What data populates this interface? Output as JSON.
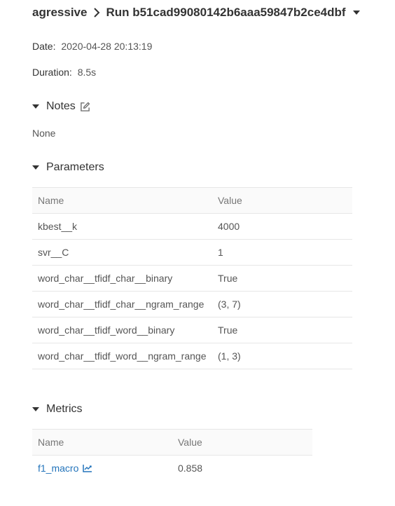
{
  "breadcrumb": {
    "experiment": "agressive",
    "run": "Run b51cad99080142b6aaa59847b2ce4dbf"
  },
  "meta": {
    "date_label": "Date:",
    "date_value": "2020-04-28 20:13:19",
    "duration_label": "Duration:",
    "duration_value": "8.5s"
  },
  "notes": {
    "title": "Notes",
    "text": "None"
  },
  "parameters": {
    "title": "Parameters",
    "columns": [
      "Name",
      "Value"
    ],
    "rows": [
      {
        "name": "kbest__k",
        "value": "4000"
      },
      {
        "name": "svr__C",
        "value": "1"
      },
      {
        "name": "word_char__tfidf_char__binary",
        "value": "True"
      },
      {
        "name": "word_char__tfidf_char__ngram_range",
        "value": "(3, 7)"
      },
      {
        "name": "word_char__tfidf_word__binary",
        "value": "True"
      },
      {
        "name": "word_char__tfidf_word__ngram_range",
        "value": "(1, 3)"
      }
    ]
  },
  "metrics": {
    "title": "Metrics",
    "columns": [
      "Name",
      "Value"
    ],
    "rows": [
      {
        "name": "f1_macro",
        "value": "0.858"
      }
    ]
  },
  "colors": {
    "link": "#2374bb",
    "text": "#333333",
    "border": "#e6e6e6"
  },
  "icons": {
    "breadcrumb_separator": "chevron-right-icon",
    "run_menu": "caret-down-icon",
    "section_toggle": "caret-down-icon",
    "notes_edit": "edit-icon",
    "metric_chart": "line-chart-icon"
  }
}
